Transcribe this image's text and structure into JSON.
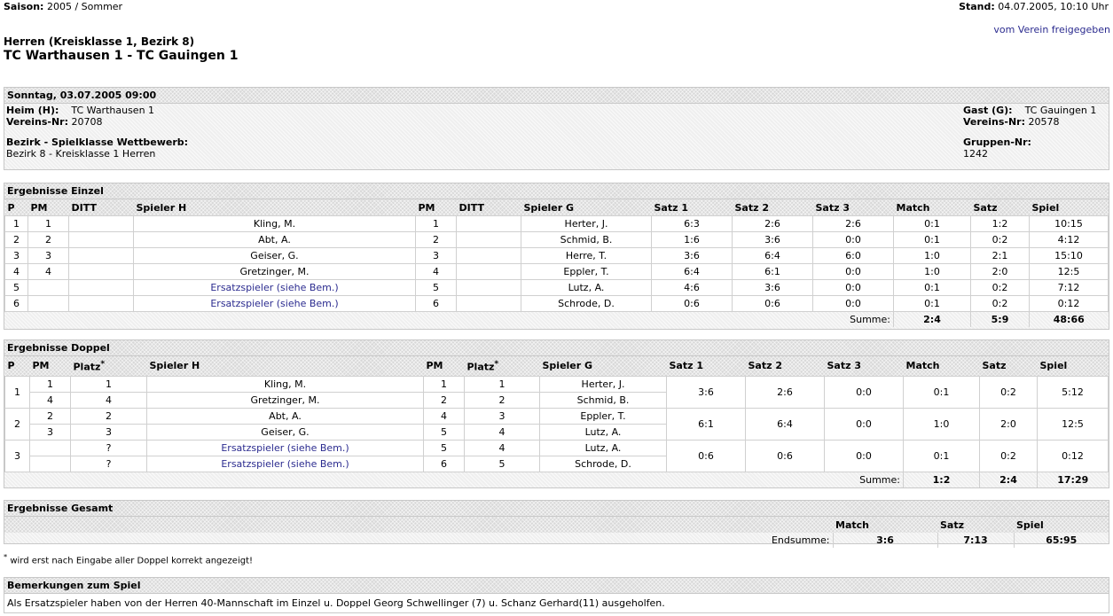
{
  "header": {
    "season_label": "Saison:",
    "season_value": "2005 / Sommer",
    "stand_label": "Stand:",
    "stand_value": "04.07.2005, 10:10 Uhr",
    "league": "Herren (Kreisklasse 1, Bezirk 8)",
    "match_title": "TC Warthausen 1 - TC Gauingen 1",
    "released_link": "vom Verein freigegeben"
  },
  "info": {
    "date": "Sonntag, 03.07.2005 09:00",
    "home_label": "Heim (H):",
    "home_team": "TC Warthausen 1",
    "home_club_label": "Vereins-Nr:",
    "home_club_nr": "20708",
    "guest_label": "Gast (G):",
    "guest_team": "TC Gauingen 1",
    "guest_club_label": "Vereins-Nr:",
    "guest_club_nr": "20578",
    "district_label": "Bezirk - Spielklasse Wettbewerb:",
    "district_value": "Bezirk 8 - Kreisklasse 1 Herren",
    "group_label": "Gruppen-Nr:",
    "group_value": "1242"
  },
  "singles": {
    "title": "Ergebnisse Einzel",
    "columns": [
      "P",
      "PM",
      "DITT",
      "Spieler H",
      "PM",
      "DITT",
      "Spieler G",
      "Satz 1",
      "Satz 2",
      "Satz 3",
      "Match",
      "Satz",
      "Spiel"
    ],
    "rows": [
      {
        "p": "1",
        "pm_h": "1",
        "ditt_h": "",
        "player_h": "Kling, M.",
        "h_link": false,
        "pm_g": "1",
        "ditt_g": "",
        "player_g": "Herter, J.",
        "s1": "6:3",
        "s2": "2:6",
        "s3": "2:6",
        "match": "0:1",
        "satz": "1:2",
        "spiel": "10:15"
      },
      {
        "p": "2",
        "pm_h": "2",
        "ditt_h": "",
        "player_h": "Abt, A.",
        "h_link": false,
        "pm_g": "2",
        "ditt_g": "",
        "player_g": "Schmid, B.",
        "s1": "1:6",
        "s2": "3:6",
        "s3": "0:0",
        "match": "0:1",
        "satz": "0:2",
        "spiel": "4:12"
      },
      {
        "p": "3",
        "pm_h": "3",
        "ditt_h": "",
        "player_h": "Geiser, G.",
        "h_link": false,
        "pm_g": "3",
        "ditt_g": "",
        "player_g": "Herre, T.",
        "s1": "3:6",
        "s2": "6:4",
        "s3": "6:0",
        "match": "1:0",
        "satz": "2:1",
        "spiel": "15:10"
      },
      {
        "p": "4",
        "pm_h": "4",
        "ditt_h": "",
        "player_h": "Gretzinger, M.",
        "h_link": false,
        "pm_g": "4",
        "ditt_g": "",
        "player_g": "Eppler, T.",
        "s1": "6:4",
        "s2": "6:1",
        "s3": "0:0",
        "match": "1:0",
        "satz": "2:0",
        "spiel": "12:5"
      },
      {
        "p": "5",
        "pm_h": "",
        "ditt_h": "",
        "player_h": "Ersatzspieler (siehe Bem.)",
        "h_link": true,
        "pm_g": "5",
        "ditt_g": "",
        "player_g": "Lutz, A.",
        "s1": "4:6",
        "s2": "3:6",
        "s3": "0:0",
        "match": "0:1",
        "satz": "0:2",
        "spiel": "7:12"
      },
      {
        "p": "6",
        "pm_h": "",
        "ditt_h": "",
        "player_h": "Ersatzspieler (siehe Bem.)",
        "h_link": true,
        "pm_g": "6",
        "ditt_g": "",
        "player_g": "Schrode, D.",
        "s1": "0:6",
        "s2": "0:6",
        "s3": "0:0",
        "match": "0:1",
        "satz": "0:2",
        "spiel": "0:12"
      }
    ],
    "sum_label": "Summe:",
    "sum_match": "2:4",
    "sum_satz": "5:9",
    "sum_spiel": "48:66"
  },
  "doubles": {
    "title": "Ergebnisse Doppel",
    "columns": [
      "P",
      "PM",
      "Platz",
      "Spieler H",
      "PM",
      "Platz",
      "Spieler G",
      "Satz 1",
      "Satz 2",
      "Satz 3",
      "Match",
      "Satz",
      "Spiel"
    ],
    "asterisk": "*",
    "pairs": [
      {
        "p": "1",
        "players": [
          {
            "pm_h": "1",
            "platz_h": "1",
            "player_h": "Kling, M.",
            "h_link": false,
            "pm_g": "1",
            "platz_g": "1",
            "player_g": "Herter, J."
          },
          {
            "pm_h": "4",
            "platz_h": "4",
            "player_h": "Gretzinger, M.",
            "h_link": false,
            "pm_g": "2",
            "platz_g": "2",
            "player_g": "Schmid, B."
          }
        ],
        "s1": "3:6",
        "s2": "2:6",
        "s3": "0:0",
        "match": "0:1",
        "satz": "0:2",
        "spiel": "5:12"
      },
      {
        "p": "2",
        "players": [
          {
            "pm_h": "2",
            "platz_h": "2",
            "player_h": "Abt, A.",
            "h_link": false,
            "pm_g": "4",
            "platz_g": "3",
            "player_g": "Eppler, T."
          },
          {
            "pm_h": "3",
            "platz_h": "3",
            "player_h": "Geiser, G.",
            "h_link": false,
            "pm_g": "5",
            "platz_g": "4",
            "player_g": "Lutz, A."
          }
        ],
        "s1": "6:1",
        "s2": "6:4",
        "s3": "0:0",
        "match": "1:0",
        "satz": "2:0",
        "spiel": "12:5"
      },
      {
        "p": "3",
        "players": [
          {
            "pm_h": "",
            "platz_h": "?",
            "player_h": "Ersatzspieler (siehe Bem.)",
            "h_link": true,
            "pm_g": "5",
            "platz_g": "4",
            "player_g": "Lutz, A."
          },
          {
            "pm_h": "",
            "platz_h": "?",
            "player_h": "Ersatzspieler (siehe Bem.)",
            "h_link": true,
            "pm_g": "6",
            "platz_g": "5",
            "player_g": "Schrode, D."
          }
        ],
        "s1": "0:6",
        "s2": "0:6",
        "s3": "0:0",
        "match": "0:1",
        "satz": "0:2",
        "spiel": "0:12"
      }
    ],
    "sum_label": "Summe:",
    "sum_match": "1:2",
    "sum_satz": "2:4",
    "sum_spiel": "17:29"
  },
  "total": {
    "title": "Ergebnisse Gesamt",
    "col_match": "Match",
    "col_satz": "Satz",
    "col_spiel": "Spiel",
    "sum_label": "Endsumme:",
    "match": "3:6",
    "satz": "7:13",
    "spiel": "65:95"
  },
  "footnote": {
    "mark": "*",
    "text": " wird erst nach Eingabe aller Doppel korrekt angezeigt!"
  },
  "remarks": {
    "title": "Bemerkungen zum Spiel",
    "text": "Als Ersatzspieler haben von der Herren 40-Mannschaft im Einzel u. Doppel Georg Schwellinger (7) u. Schanz Gerhard(11) ausgeholfen."
  }
}
